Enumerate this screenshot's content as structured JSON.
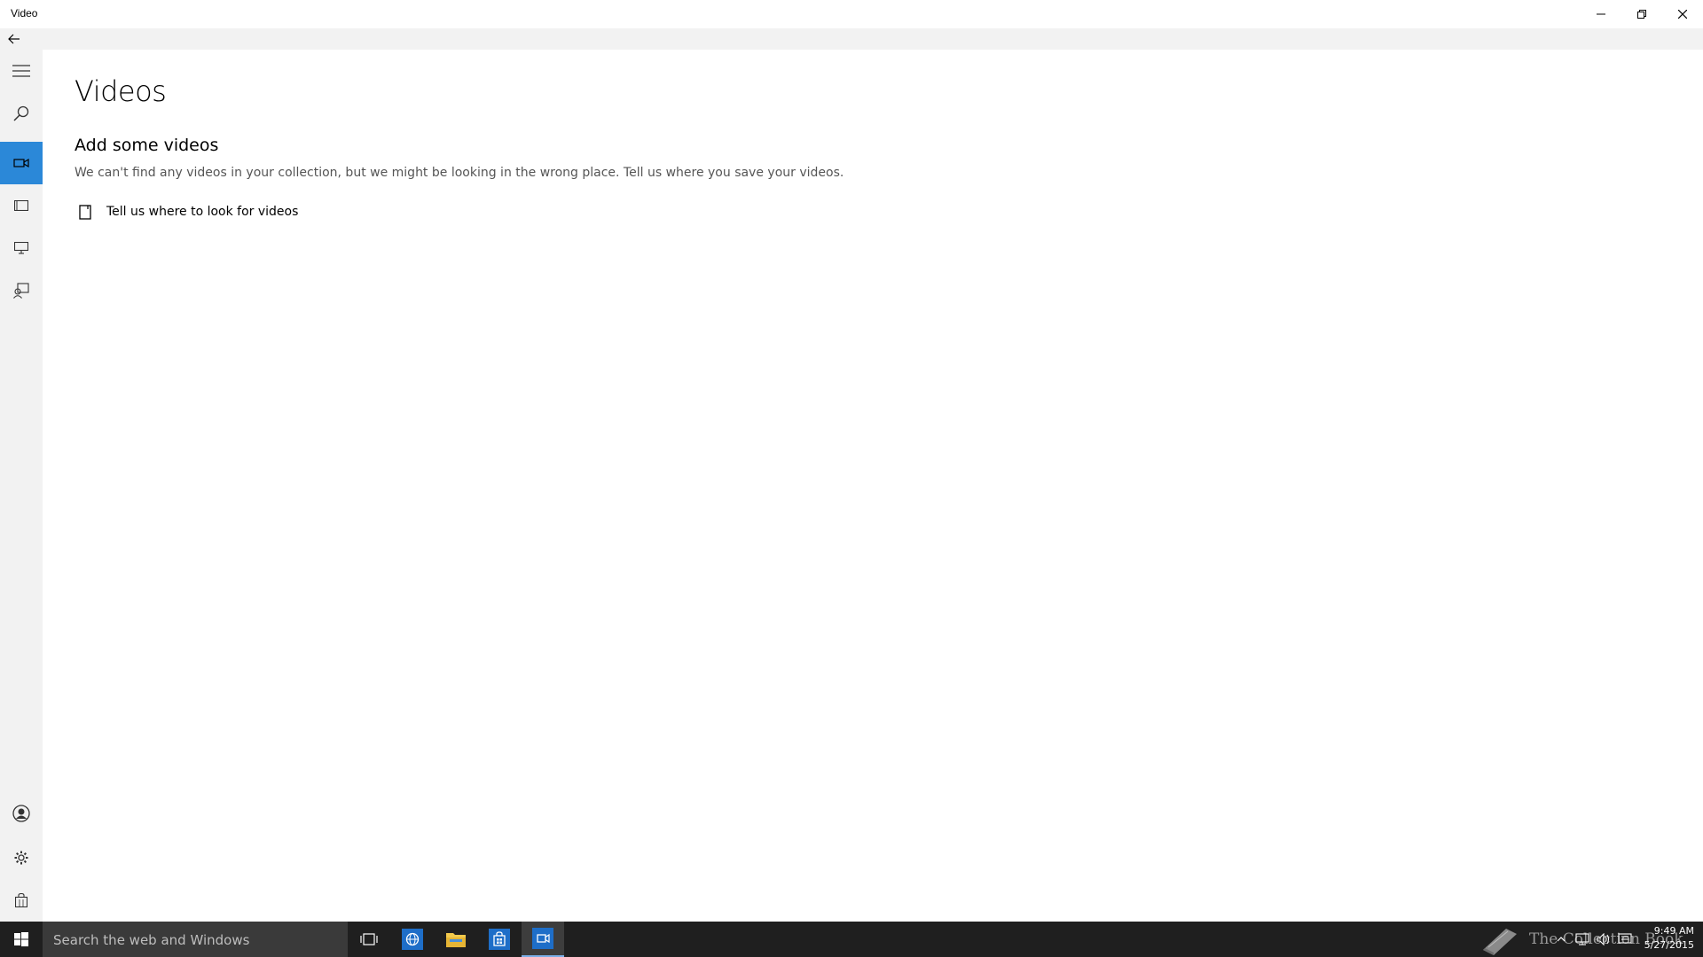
{
  "window": {
    "title": "Video"
  },
  "nav": {
    "items": [
      {
        "icon": "hamburger-icon"
      },
      {
        "icon": "search-icon"
      },
      {
        "icon": "video-camera-icon",
        "selected": true
      },
      {
        "icon": "movies-icon"
      },
      {
        "icon": "tv-icon"
      },
      {
        "icon": "feedback-icon"
      },
      {
        "icon": "account-icon"
      },
      {
        "icon": "gear-icon"
      },
      {
        "icon": "store-bag-icon"
      }
    ]
  },
  "main": {
    "page_title": "Videos",
    "section_title": "Add some videos",
    "description": "We can't find any videos in your collection, but we might be looking in the wrong place. Tell us where you save your videos.",
    "look_link_label": "Tell us where to look for videos"
  },
  "taskbar": {
    "search_placeholder": "Search the web and Windows",
    "watermark": "The Collection Book",
    "clock_time": "9:49 AM",
    "clock_date": "5/27/2015"
  },
  "colors": {
    "accent": "#2b88d8",
    "rail_bg": "#f2f2f2",
    "taskbar_bg": "#1f1f1f"
  }
}
